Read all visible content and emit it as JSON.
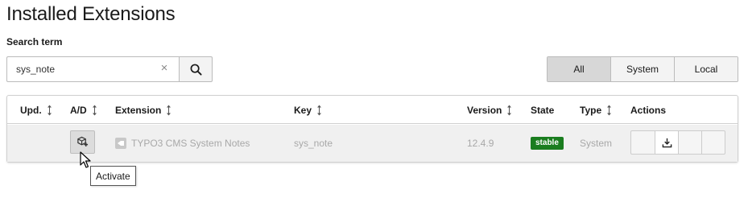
{
  "page": {
    "title": "Installed Extensions"
  },
  "search": {
    "label": "Search term",
    "value": "sys_note",
    "placeholder": "",
    "clear_icon": "×",
    "button_icon": "search-icon"
  },
  "filters": {
    "items": [
      {
        "label": "All",
        "active": true
      },
      {
        "label": "System",
        "active": false
      },
      {
        "label": "Local",
        "active": false
      }
    ]
  },
  "table": {
    "columns": [
      {
        "key": "upd",
        "label": "Upd.",
        "sortable": true
      },
      {
        "key": "ad",
        "label": "A/D",
        "sortable": true
      },
      {
        "key": "extension",
        "label": "Extension",
        "sortable": true
      },
      {
        "key": "key",
        "label": "Key",
        "sortable": true
      },
      {
        "key": "version",
        "label": "Version",
        "sortable": true
      },
      {
        "key": "state",
        "label": "State",
        "sortable": false
      },
      {
        "key": "type",
        "label": "Type",
        "sortable": true
      },
      {
        "key": "actions",
        "label": "Actions",
        "sortable": false
      }
    ],
    "rows": [
      {
        "upd": "",
        "ad_icon": "activate-extension-icon",
        "extension": "TYPO3 CMS System Notes",
        "key": "sys_note",
        "version": "12.4.9",
        "state": "stable",
        "type": "System",
        "actions_icons": [
          "",
          "download-icon",
          "",
          ""
        ]
      }
    ]
  },
  "tooltip": {
    "text": "Activate"
  },
  "colors": {
    "accent_active_filter": "#d7d7d7",
    "state_stable": "#1a7d1f",
    "row_background": "#f0f0f0",
    "muted_text": "#a8a8a8"
  }
}
